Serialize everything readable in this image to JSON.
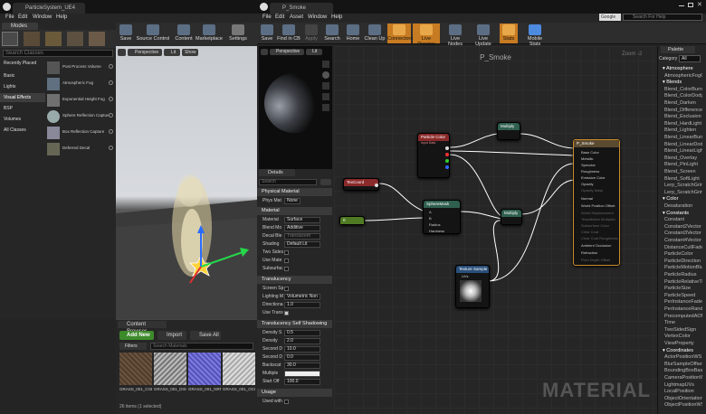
{
  "left_window": {
    "tab_title": "ParticleSystem_UE4",
    "menu": [
      "File",
      "Edit",
      "Window",
      "Help"
    ],
    "modes_label": "Modes",
    "search_placeholder": "Search Classes",
    "categories": [
      "Recently Placed",
      "Basic",
      "Lights",
      "Visual Effects",
      "BSP",
      "Volumes",
      "All Classes"
    ],
    "selected_category": "Visual Effects",
    "place_items": [
      "Post Process Volume",
      "Atmospheric Fog",
      "Exponential Height Fog",
      "Sphere Reflection Capture",
      "Box Reflection Capture",
      "Deferred Decal"
    ],
    "toolbar": [
      "Save",
      "Source Control",
      "Content",
      "Marketplace",
      "Settings"
    ],
    "viewport": {
      "perspective": "Perspective",
      "lit": "Lit",
      "show": "Show"
    },
    "content_browser": {
      "tab": "Content Browser",
      "add_new": "Add New",
      "import": "Import",
      "save_all": "Save All",
      "filters": "Filters",
      "search_placeholder": "Search Materials",
      "assets": [
        "GRASS_001_COLOR",
        "GRASS_001_DISP",
        "GRASS_001_NRM",
        "GRASS_001_OCC"
      ],
      "status": "26 items (1 selected)"
    }
  },
  "right_window": {
    "tab_title": "P_Smoke",
    "menu": [
      "File",
      "Edit",
      "Asset",
      "Window",
      "Help"
    ],
    "search_help_placeholder": "Search For Help",
    "google_label": "Google",
    "toolbar": [
      "Save",
      "Find in CB",
      "Apply",
      "Search",
      "Home",
      "Clean Up",
      "Connectors",
      "Live Preview",
      "Live Nodes",
      "Live Update",
      "Stats",
      "Mobile Stats"
    ],
    "preview": {
      "perspective": "Perspective",
      "lit": "Lit"
    },
    "details": {
      "tab": "Details",
      "search_placeholder": "Search",
      "sections": {
        "physical_material": "Physical Material",
        "material": "Material",
        "translucency": "Translucency",
        "self_shadowing": "Translucency Self Shadowing",
        "usage": "Usage"
      },
      "phys_mat_label": "Phys Mat",
      "phys_mat_value": "None",
      "material_rows": [
        {
          "label": "Material",
          "value": "Surface"
        },
        {
          "label": "Blend Mo",
          "value": "Additive"
        },
        {
          "label": "Decal Ble",
          "value": "Translucent"
        },
        {
          "label": "Shading",
          "value": "Default Lit"
        }
      ],
      "material_checks": [
        "Two Sides",
        "Use Mate",
        "Subsurfac"
      ],
      "translucency_rows": [
        "Screen Sp",
        "Lighting M",
        "Directiona",
        "Use Trans"
      ],
      "lighting_mode_value": "Volumetric Non",
      "directional_value": "1.0",
      "self_shadow_rows": [
        {
          "label": "Density S",
          "value": "0.5"
        },
        {
          "label": "Density",
          "value": "2.0"
        },
        {
          "label": "Second D",
          "value": "10.0"
        },
        {
          "label": "Second D",
          "value": "0.0"
        },
        {
          "label": "Backscat",
          "value": "30.0"
        },
        {
          "label": "Multiple",
          "value": ""
        },
        {
          "label": "Start Off",
          "value": "100.0"
        }
      ],
      "usage_row": "Used with"
    },
    "graph": {
      "title": "P_Smoke",
      "zoom": "Zoom -2",
      "watermark": "MATERIAL",
      "nodes": {
        "particle_color": {
          "title": "Particle Color",
          "sub": "Input Data"
        },
        "texcoord": {
          "title": "TexCoord"
        },
        "const": {
          "title": "0"
        },
        "sphere_mask": {
          "title": "SphereMask",
          "pins": [
            "A",
            "B",
            "Radius",
            "Hardness"
          ]
        },
        "multiply1": {
          "title": "Multiply"
        },
        "multiply2": {
          "title": "Multiply"
        },
        "texture_sample": {
          "title": "Texture Sample",
          "pin": "UVs"
        },
        "result": {
          "title": "P_Smoke",
          "pins": [
            "Base Color",
            "Metallic",
            "Specular",
            "Roughness",
            "Emissive Color",
            "Opacity",
            "Opacity Mask",
            "Normal",
            "World Position Offset",
            "World Displacement",
            "Tessellation Multiplier",
            "Subsurface Color",
            "Clear Coat",
            "Clear Coat Roughness",
            "Ambient Occlusion",
            "Refraction",
            "Pixel Depth Offset"
          ]
        }
      }
    },
    "palette": {
      "tab": "Palette",
      "category_label": "Category",
      "category_value": "All",
      "items": [
        {
          "t": "cat",
          "v": "Atmosphere"
        },
        {
          "t": "i",
          "v": "AtmosphericFogColor"
        },
        {
          "t": "cat",
          "v": "Blends"
        },
        {
          "t": "i",
          "v": "Blend_ColorBurn"
        },
        {
          "t": "i",
          "v": "Blend_ColorDodge"
        },
        {
          "t": "i",
          "v": "Blend_Darken"
        },
        {
          "t": "i",
          "v": "Blend_Difference"
        },
        {
          "t": "i",
          "v": "Blend_Exclusion"
        },
        {
          "t": "i",
          "v": "Blend_HardLight"
        },
        {
          "t": "i",
          "v": "Blend_Lighten"
        },
        {
          "t": "i",
          "v": "Blend_LinearBurn"
        },
        {
          "t": "i",
          "v": "Blend_LinearDodge"
        },
        {
          "t": "i",
          "v": "Blend_LinearLight"
        },
        {
          "t": "i",
          "v": "Blend_Overlay"
        },
        {
          "t": "i",
          "v": "Blend_PinLight"
        },
        {
          "t": "i",
          "v": "Blend_Screen"
        },
        {
          "t": "i",
          "v": "Blend_SoftLight"
        },
        {
          "t": "i",
          "v": "Lerp_ScratchGrime"
        },
        {
          "t": "i",
          "v": "Lerp_ScratchGrime2"
        },
        {
          "t": "cat",
          "v": "Color"
        },
        {
          "t": "i",
          "v": "Desaturation"
        },
        {
          "t": "cat",
          "v": "Constants"
        },
        {
          "t": "i",
          "v": "Constant"
        },
        {
          "t": "i",
          "v": "Constant2Vector"
        },
        {
          "t": "i",
          "v": "Constant3Vector"
        },
        {
          "t": "i",
          "v": "Constant4Vector"
        },
        {
          "t": "i",
          "v": "DistanceCullFade"
        },
        {
          "t": "i",
          "v": "ParticleColor"
        },
        {
          "t": "i",
          "v": "ParticleDirection"
        },
        {
          "t": "i",
          "v": "ParticleMotionBlurFade"
        },
        {
          "t": "i",
          "v": "ParticleRadius"
        },
        {
          "t": "i",
          "v": "ParticleRelativeTime"
        },
        {
          "t": "i",
          "v": "ParticleSize"
        },
        {
          "t": "i",
          "v": "ParticleSpeed"
        },
        {
          "t": "i",
          "v": "PerInstanceFadeAmount"
        },
        {
          "t": "i",
          "v": "PerInstanceRandom"
        },
        {
          "t": "i",
          "v": "PrecomputedAOMask"
        },
        {
          "t": "i",
          "v": "Time"
        },
        {
          "t": "i",
          "v": "TwoSidedSign"
        },
        {
          "t": "i",
          "v": "VertexColor"
        },
        {
          "t": "i",
          "v": "ViewProperty"
        },
        {
          "t": "cat",
          "v": "Coordinates"
        },
        {
          "t": "i",
          "v": "ActorPositionWS"
        },
        {
          "t": "i",
          "v": "BlurSampleOffsets"
        },
        {
          "t": "i",
          "v": "BoundingBoxBased_0-1_UVW"
        },
        {
          "t": "i",
          "v": "CameraPositionWS"
        },
        {
          "t": "i",
          "v": "LightmapUVs"
        },
        {
          "t": "i",
          "v": "LocalPosition"
        },
        {
          "t": "i",
          "v": "ObjectOrientation"
        },
        {
          "t": "i",
          "v": "ObjectPositionWS"
        }
      ]
    }
  }
}
